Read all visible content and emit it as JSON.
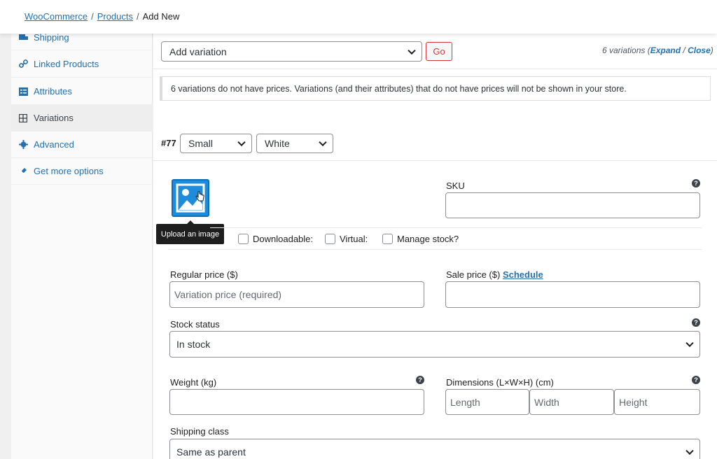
{
  "breadcrumb": {
    "woocommerce": "WooCommerce",
    "products": "Products",
    "current": "Add New",
    "sep": "/"
  },
  "tabs": [
    {
      "label": "Shipping",
      "icon": "truck-icon"
    },
    {
      "label": "Linked Products",
      "icon": "link-icon"
    },
    {
      "label": "Attributes",
      "icon": "list-icon"
    },
    {
      "label": "Variations",
      "icon": "grid-icon"
    },
    {
      "label": "Advanced",
      "icon": "gear-icon"
    },
    {
      "label": "Get more options",
      "icon": "plugin-icon"
    }
  ],
  "toolbar": {
    "action_select": "Add variation",
    "go_label": "Go",
    "count_text": "6 variations (",
    "expand_label": "Expand",
    "slash": " / ",
    "close_label": "Close",
    "close_paren": ")"
  },
  "notice": "6 variations do not have prices. Variations (and their attributes) that do not have prices will not be shown in your store.",
  "variation": {
    "id": "#77",
    "size": "Small",
    "color": "White",
    "tooltip": "Upload an image",
    "sku_label": "SKU",
    "sku_value": "",
    "downloadable": "Downloadable:",
    "virtual": "Virtual:",
    "manage_stock": "Manage stock?",
    "regular_price_label": "Regular price ($)",
    "regular_price_placeholder": "Variation price (required)",
    "sale_price_label": "Sale price ($)",
    "schedule_label": "Schedule",
    "stock_status_label": "Stock status",
    "stock_status_value": "In stock",
    "weight_label": "Weight (kg)",
    "dimensions_label": "Dimensions (L×W×H) (cm)",
    "length_placeholder": "Length",
    "width_placeholder": "Width",
    "height_placeholder": "Height",
    "shipping_class_label": "Shipping class",
    "shipping_class_value": "Same as parent"
  },
  "colors": {
    "link": "#2271b1",
    "go_button": "#d63638",
    "image_button": "#1e8cda"
  }
}
